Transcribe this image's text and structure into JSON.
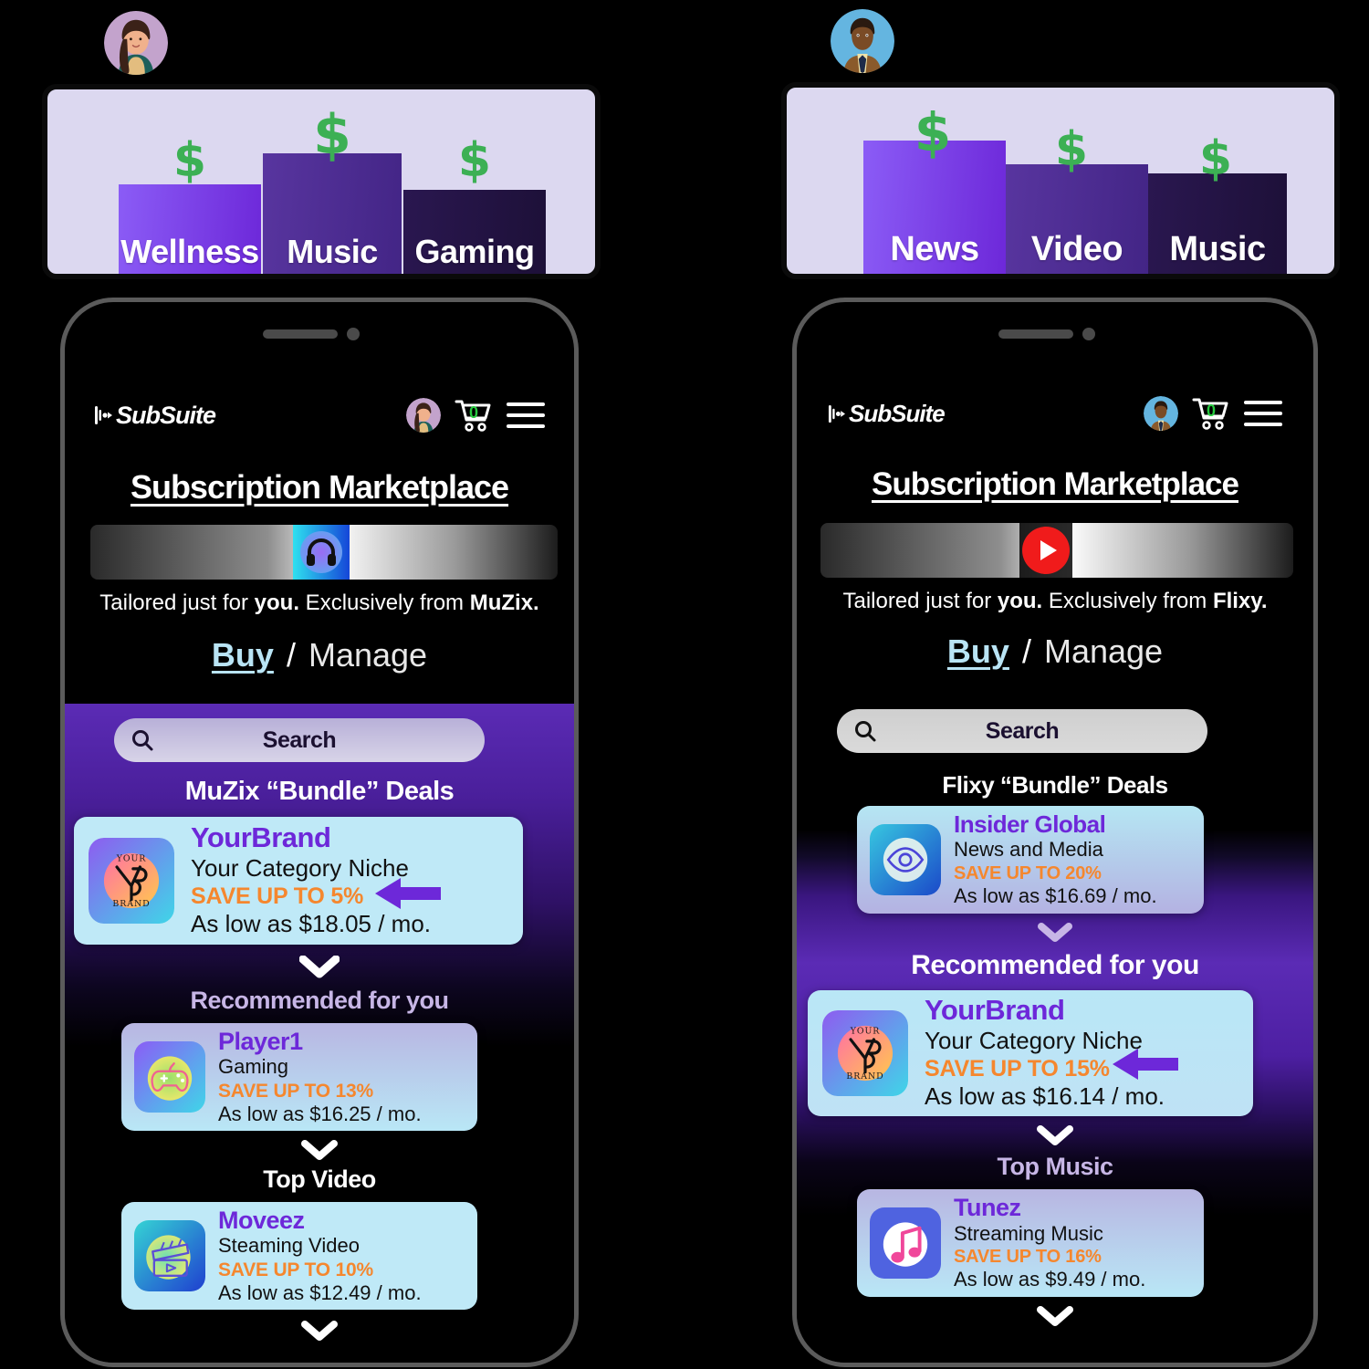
{
  "chart_data": [
    {
      "type": "bar",
      "title": "",
      "categories": [
        "Wellness",
        "Music",
        "Gaming"
      ],
      "values": [
        60,
        80,
        57
      ],
      "colors": [
        "#7b3ff2",
        "#4c2a94",
        "#231343"
      ],
      "value_marker": "$",
      "xlabel": "",
      "ylabel": "",
      "ylim": [
        0,
        100
      ],
      "grid": false,
      "legend": "none"
    },
    {
      "type": "bar",
      "title": "",
      "categories": [
        "News",
        "Video",
        "Music"
      ],
      "values": [
        84,
        62,
        52
      ],
      "colors": [
        "#7b3ff2",
        "#4c2a94",
        "#231343"
      ],
      "value_marker": "$",
      "xlabel": "",
      "ylabel": "",
      "ylim": [
        0,
        100
      ],
      "grid": false,
      "legend": "none"
    }
  ],
  "theme": {
    "accent_purple": "#6d28d9",
    "save_orange": "#f5872e",
    "chart_bg": "#dcd8f0",
    "dollar_green": "#3cb054",
    "buy_blue": "#b9e4f5",
    "cart_green": "#27c93f"
  },
  "left": {
    "avatar": "woman-avatar",
    "phone": {
      "header": {
        "brand_mark": "subsuite-logo-icon",
        "brand": "SubSuite",
        "avatar": "woman-avatar",
        "cart_icon": "shopping-cart-icon",
        "cart_count": "0",
        "menu_icon": "hamburger-menu-icon"
      },
      "page_title": "Subscription Marketplace",
      "banner_icon": "headphones-icon",
      "tagline_pre": "Tailored just for ",
      "tagline_you": "you.",
      "tagline_mid": " Exclusively from ",
      "tagline_brand": "MuZix.",
      "tabs": {
        "buy": "Buy",
        "sep": "/",
        "manage": "Manage"
      },
      "search": {
        "icon": "search-icon",
        "label": "Search"
      },
      "sections": [
        {
          "title": "MuZix “Bundle” Deals",
          "color": "#ffffff"
        },
        {
          "title": "Recommended for you",
          "color": "#c7b6e6"
        },
        {
          "title": "Top Video",
          "color": "#ffffff"
        }
      ],
      "cards": [
        {
          "logo": "yourbrand-logo-icon",
          "name": "YourBrand",
          "category": "Your Category Niche",
          "save": "SAVE UP TO 5%",
          "price": "As low as $18.05 / mo.",
          "has_arrow": true
        },
        {
          "logo": "gamepad-icon",
          "name": "Player1",
          "category": "Gaming",
          "save": "SAVE UP TO 13%",
          "price": "As low as $16.25 / mo.",
          "has_arrow": false
        },
        {
          "logo": "clapperboard-icon",
          "name": "Moveez",
          "category": "Steaming Video",
          "save": "SAVE UP TO 10%",
          "price": "As low as $12.49 / mo.",
          "has_arrow": false
        }
      ]
    }
  },
  "right": {
    "avatar": "man-avatar",
    "phone": {
      "header": {
        "brand_mark": "subsuite-logo-icon",
        "brand": "SubSuite",
        "avatar": "man-avatar",
        "cart_icon": "shopping-cart-icon",
        "cart_count": "0",
        "menu_icon": "hamburger-menu-icon"
      },
      "page_title": "Subscription Marketplace",
      "banner_icon": "play-button-icon",
      "tagline_pre": "Tailored just for ",
      "tagline_you": "you.",
      "tagline_mid": " Exclusively from ",
      "tagline_brand": "Flixy.",
      "tabs": {
        "buy": "Buy",
        "sep": "/",
        "manage": "Manage"
      },
      "search": {
        "icon": "search-icon",
        "label": "Search"
      },
      "sections": [
        {
          "title": "Flixy “Bundle” Deals",
          "color": "#ffffff"
        },
        {
          "title": "Recommended for you",
          "color": "#ffffff"
        },
        {
          "title": "Top Music",
          "color": "#c7b6e6"
        }
      ],
      "cards": [
        {
          "logo": "eye-icon",
          "name": "Insider Global",
          "category": "News and Media",
          "save": "SAVE UP TO 20%",
          "price": "As low as $16.69 / mo.",
          "has_arrow": false
        },
        {
          "logo": "yourbrand-logo-icon",
          "name": "YourBrand",
          "category": "Your Category Niche",
          "save": "SAVE UP TO 15%",
          "price": "As low as $16.14 / mo.",
          "has_arrow": true
        },
        {
          "logo": "music-note-icon",
          "name": "Tunez",
          "category": "Streaming Music",
          "save": "SAVE UP TO 16%",
          "price": "As low as $9.49 / mo.",
          "has_arrow": false
        }
      ]
    }
  }
}
